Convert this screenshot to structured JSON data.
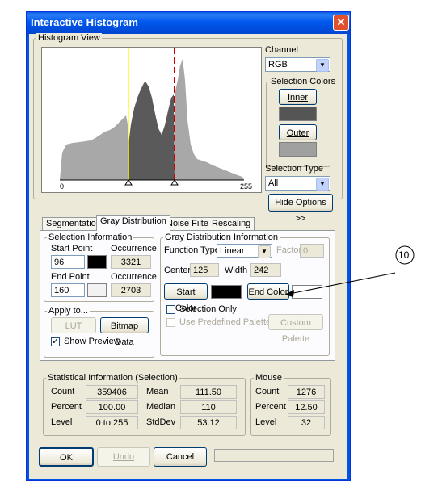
{
  "window": {
    "title": "Interactive Histogram"
  },
  "histogram_view": {
    "label": "Histogram View",
    "axis_min": "0",
    "axis_max": "255"
  },
  "channel": {
    "label": "Channel",
    "value": "RGB"
  },
  "selection_colors": {
    "label": "Selection Colors",
    "inner_label": "Inner",
    "outer_label": "Outer",
    "inner_color": "#555555",
    "outer_color": "#a0a0a0"
  },
  "selection_type": {
    "label": "Selection Type",
    "value": "All"
  },
  "hide_options_label": "Hide Options >>",
  "tabs": [
    {
      "label": "Segmentation"
    },
    {
      "label": "Gray Distribution"
    },
    {
      "label": "Noise Filter"
    },
    {
      "label": "Rescaling"
    }
  ],
  "selection_info": {
    "label": "Selection Information",
    "start_point_label": "Start Point",
    "start_point_value": "96",
    "start_occurrence_label": "Occurrence",
    "start_occurrence_value": "3321",
    "end_point_label": "End Point",
    "end_point_value": "160",
    "end_occurrence_label": "Occurrence",
    "end_occurrence_value": "2703"
  },
  "apply_to": {
    "label": "Apply to...",
    "lut_label": "LUT",
    "bitmap_label": "Bitmap Data",
    "show_preview_label": "Show Preview"
  },
  "gray_distribution": {
    "label": "Gray Distribution Information",
    "function_type_label": "Function Type",
    "function_type_value": "Linear",
    "factor_label": "Factor",
    "factor_value": "0",
    "center_label": "Center",
    "center_value": "125",
    "width_label": "Width",
    "width_value": "242",
    "start_color_label": "Start Color",
    "end_color_label": "End Color",
    "selection_only_label": "Selection Only",
    "use_palette_label": "Use Predefined Palette",
    "custom_palette_label": "Custom Palette"
  },
  "stats": {
    "label": "Statistical Information (Selection)",
    "count_label": "Count",
    "count_value": "359406",
    "percent_label": "Percent",
    "percent_value": "100.00",
    "level_label": "Level",
    "level_value": "0 to 255",
    "mean_label": "Mean",
    "mean_value": "111.50",
    "median_label": "Median",
    "median_value": "110",
    "stddev_label": "StdDev",
    "stddev_value": "53.12"
  },
  "mouse": {
    "label": "Mouse",
    "count_label": "Count",
    "count_value": "1276",
    "percent_label": "Percent",
    "percent_value": "12.50",
    "level_label": "Level",
    "level_value": "32"
  },
  "buttons": {
    "ok": "OK",
    "undo": "Undo",
    "cancel": "Cancel"
  },
  "callout": {
    "number": "10"
  }
}
